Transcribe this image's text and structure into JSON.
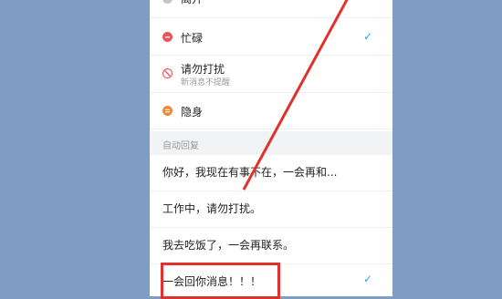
{
  "status": {
    "items": [
      {
        "label": "离开",
        "icon": "clock-icon",
        "color": "#b0b0b0"
      },
      {
        "label": "忙碌",
        "icon": "minus-circle-icon",
        "color": "#e8555a",
        "checked": true
      },
      {
        "label": "请勿打扰",
        "sublabel": "新消息不提醒",
        "icon": "no-disturb-icon",
        "color": "#e8555a"
      },
      {
        "label": "隐身",
        "icon": "equals-circle-icon",
        "color": "#f0883a"
      }
    ]
  },
  "auto_reply": {
    "header": "自动回复",
    "items": [
      {
        "label": "你好，我现在有事不在，一会再和..."
      },
      {
        "label": "工作中，请勿打扰。"
      },
      {
        "label": "我去吃饭了，一会再联系。"
      },
      {
        "label": "一会回你消息！！！",
        "checked": true
      }
    ]
  },
  "check_glyph": "✓",
  "colors": {
    "accent": "#2fa3e6",
    "annotation": "#e0312c",
    "background": "#7f9dc3"
  }
}
